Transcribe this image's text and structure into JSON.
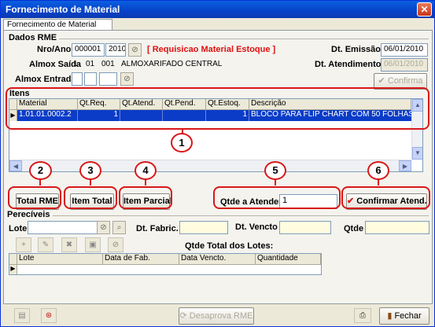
{
  "window": {
    "title": "Fornecimento de Material",
    "close": "✕"
  },
  "tab": "Fornecimento de Material",
  "dados_rme": {
    "group": "Dados RME",
    "nro_ano_label": "Nro/Ano",
    "nro": "000001",
    "ano": "2010",
    "tipo": "[ Requisicao Material Estoque ]",
    "almox_saida_label": "Almox Saída",
    "almox_saida": [
      "1",
      "01",
      "001"
    ],
    "almox_saida_nome": "ALMOXARIFADO CENTRAL",
    "almox_entrada_label": "Almox Entrada",
    "dt_emissao_label": "Dt. Emissão",
    "dt_emissao": "06/01/2010",
    "dt_atendimento_label": "Dt. Atendimento",
    "dt_atendimento": "06/01/2010",
    "confirma": "Confirma"
  },
  "itens": {
    "group": "Itens",
    "columns": [
      "Material",
      "Qt.Req.",
      "Qt.Atend.",
      "Qt.Pend.",
      "Qt.Estoq.",
      "Descrição"
    ],
    "rows": [
      {
        "material": "1.01.01.0002.2",
        "qt_req": "1",
        "qt_atend": "",
        "qt_pend": "",
        "qt_estoq": "1",
        "descricao": "BLOCO PARA FLIP CHART COM 50 FOLHAS"
      }
    ]
  },
  "actions": {
    "total_rme": "Total RME",
    "item_total": "Item Total",
    "item_parcial": "Item Parcial",
    "qtde_atender_label": "Qtde a Atender",
    "qtde_atender": "1",
    "confirmar": "Confirmar Atend."
  },
  "annotations": [
    "1",
    "2",
    "3",
    "4",
    "5",
    "6"
  ],
  "pereciveis": {
    "group": "Perecíveis",
    "lote_label": "Lote",
    "dt_fabric_label": "Dt. Fabric.",
    "dt_vencto_label": "Dt. Vencto",
    "qtde_label": "Qtde",
    "total_lotes": "Qtde Total dos Lotes:",
    "columns": [
      "Lote",
      "Data de Fab.",
      "Data Vencto.",
      "Quantidade"
    ]
  },
  "footer": {
    "desaprova": "Desaprova RME",
    "fechar": "Fechar"
  },
  "colors": {
    "title_bar": "#0842c8",
    "selection": "#0a3cc8",
    "annotation": "#d81818",
    "red_text": "#e01010"
  }
}
